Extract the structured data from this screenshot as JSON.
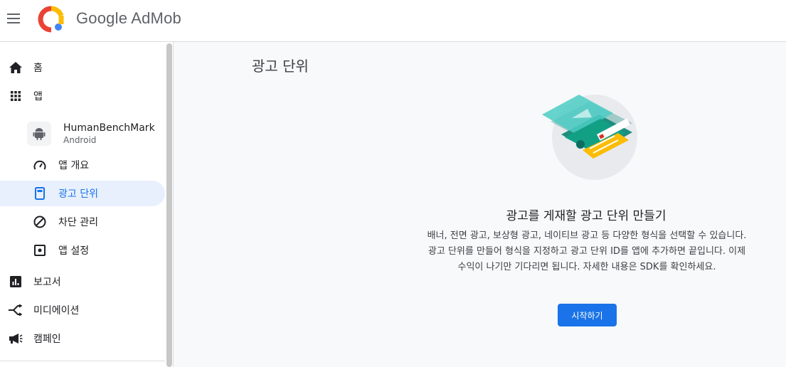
{
  "header": {
    "brand_name": "Google AdMob"
  },
  "sidebar": {
    "home": "홈",
    "apps": "앱",
    "app": {
      "name": "HumanBenchMark",
      "platform": "Android"
    },
    "app_sub_items": [
      "앱 개요",
      "광고 단위",
      "차단 관리",
      "앱 설정"
    ],
    "active_item": "광고 단위",
    "reports": "보고서",
    "mediation": "미디에이션",
    "campaigns": "캠페인"
  },
  "main": {
    "page_title": "광고 단위",
    "empty_state": {
      "title": "광고를 게재할 광고 단위 만들기",
      "description": "배너, 전면 광고, 보상형 광고, 네이티브 광고 등 다양한 형식을 선택할 수 있습니다. 광고 단위를 만들어 형식을 지정하고 광고 단위 ID를 앱에 추가하면 끝입니다. 이제 수익이 나기만 기다리면 됩니다. 자세한 내용은 SDK를 확인하세요.",
      "button_label": "시작하기"
    }
  },
  "colors": {
    "accent": "#1a73e8",
    "active_bg": "#e8f0fe",
    "main_bg": "#f8f9fa"
  },
  "icons": {
    "menu": "hamburger-icon",
    "home": "home-icon",
    "apps": "apps-grid-icon",
    "android": "android-icon",
    "overview": "speedometer-icon",
    "ad_units": "ad-unit-icon",
    "blocking": "block-icon",
    "settings": "settings-icon",
    "reports": "bar-chart-icon",
    "mediation": "mediation-icon",
    "campaigns": "megaphone-icon"
  }
}
